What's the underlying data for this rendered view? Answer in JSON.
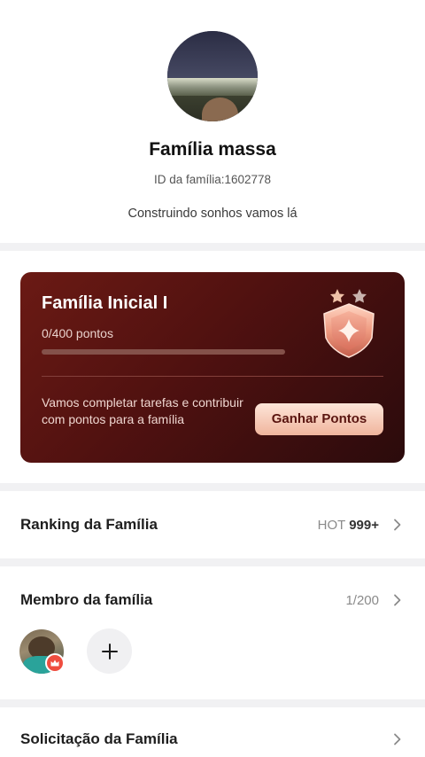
{
  "family": {
    "name": "Família massa",
    "id_label": "ID da família:",
    "id_value": "1602778",
    "motto": "Construindo sonhos vamos lá"
  },
  "level_card": {
    "title": "Família Inicial I",
    "points_text": "0/400 pontos",
    "progress_fraction": 0,
    "description": "Vamos completar tarefas e contribuir com pontos para a família",
    "earn_button": "Ganhar Pontos",
    "badge_icon": "shield-badge-icon",
    "colors": {
      "card_dark": "#2b0b0c",
      "card_red": "#6b1a14",
      "button": "#f0b59d"
    }
  },
  "ranking": {
    "title": "Ranking da Família",
    "hot_label": "HOT",
    "hot_value": "999+"
  },
  "members": {
    "title": "Membro da família",
    "count": "1/200",
    "add_icon": "plus-icon"
  },
  "requests": {
    "title": "Solicitação da Família"
  }
}
